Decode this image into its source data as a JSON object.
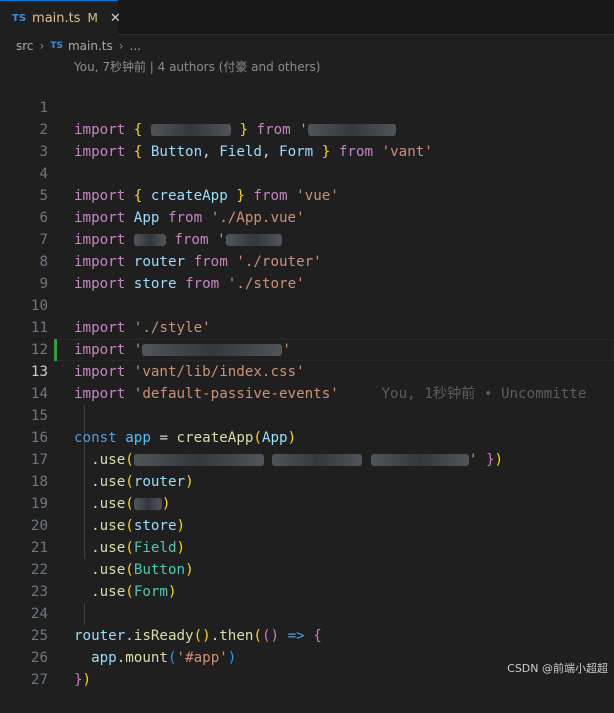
{
  "tab": {
    "lang_badge": "TS",
    "filename": "main.ts",
    "modified": "M",
    "close": "✕"
  },
  "breadcrumb": {
    "folder": "src",
    "sep": "›",
    "lang_badge": "TS",
    "file": "main.ts",
    "sep2": "›",
    "more": "..."
  },
  "blame_header": "You, 7秒钟前 | 4 authors (付豪 and others)",
  "lines": [
    "1",
    "2",
    "3",
    "4",
    "5",
    "6",
    "7",
    "8",
    "9",
    "10",
    "11",
    "12",
    "13",
    "14",
    "15",
    "16",
    "17",
    "18",
    "19",
    "20",
    "21",
    "22",
    "23",
    "24",
    "25",
    "26",
    "27"
  ],
  "code": {
    "import": "import",
    "from": "from",
    "vant": "'vant'",
    "button": "Button",
    "field": "Field",
    "form": "Form",
    "createApp": "createApp",
    "vue": "'vue'",
    "app_cls": "App",
    "app_vue": "'./App.vue'",
    "router": "router",
    "router_path": "'./router'",
    "store": "store",
    "store_path": "'./store'",
    "style": "'./style'",
    "vant_css": "'vant/lib/index.css'",
    "passive": "'default-passive-events'",
    "const": "const",
    "app": "app",
    "use": "use",
    "isReady": "isReady",
    "then": "then",
    "mount": "mount",
    "app_id": "'#app'"
  },
  "inline_blame": "You, 1秒钟前 • Uncommitte",
  "watermark": "CSDN @前端小超超"
}
